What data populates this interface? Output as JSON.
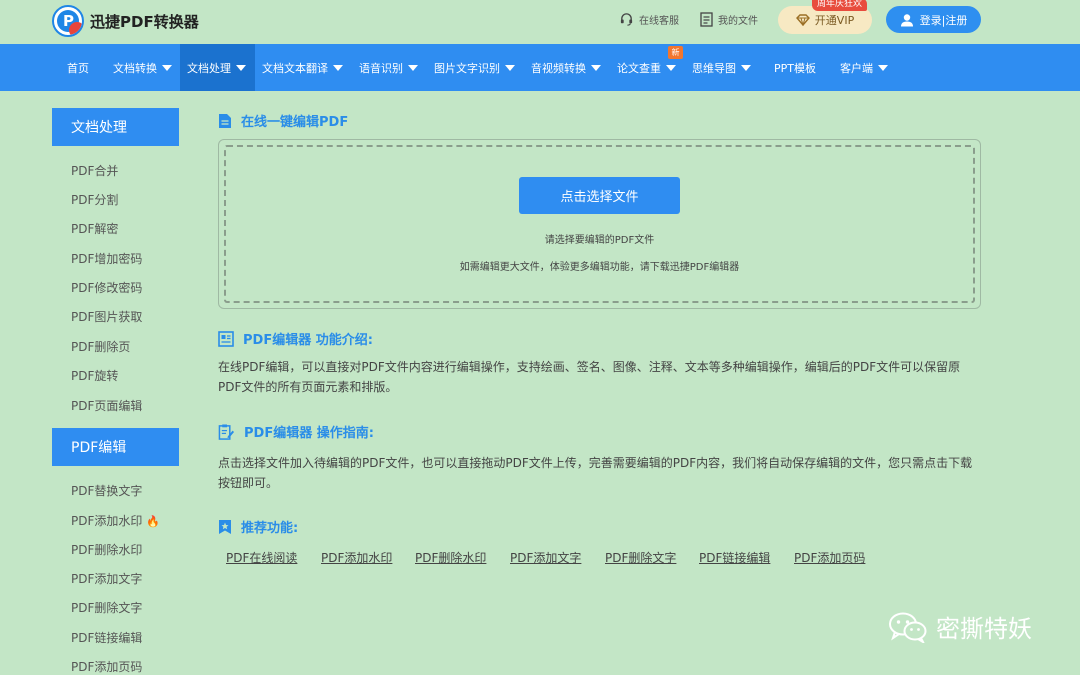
{
  "header": {
    "logo_text": "迅捷PDF转换器",
    "online_service": "在线客服",
    "my_files": "我的文件",
    "vip_badge": "周年庆狂欢",
    "vip_label": "开通VIP",
    "login_label": "登录|注册"
  },
  "nav": {
    "items": [
      {
        "label": "首页"
      },
      {
        "label": "文档转换"
      },
      {
        "label": "文档处理"
      },
      {
        "label": "文档文本翻译"
      },
      {
        "label": "语音识别"
      },
      {
        "label": "图片文字识别"
      },
      {
        "label": "音视频转换"
      },
      {
        "label": "论文查重"
      },
      {
        "label": "思维导图"
      },
      {
        "label": "PPT模板"
      },
      {
        "label": "客户端"
      }
    ],
    "new_badge": "新",
    "active": "文档处理"
  },
  "sidebar": {
    "group1_title": "文档处理",
    "group1_items": [
      {
        "label": "PDF合并"
      },
      {
        "label": "PDF分割"
      },
      {
        "label": "PDF解密"
      },
      {
        "label": "PDF增加密码"
      },
      {
        "label": "PDF修改密码"
      },
      {
        "label": "PDF图片获取"
      },
      {
        "label": "PDF删除页"
      },
      {
        "label": "PDF旋转"
      },
      {
        "label": "PDF页面编辑"
      }
    ],
    "group2_title": "PDF编辑",
    "group2_items": [
      {
        "label": "PDF替换文字"
      },
      {
        "label": "PDF添加水印"
      },
      {
        "label": "PDF删除水印"
      },
      {
        "label": "PDF添加文字"
      },
      {
        "label": "PDF删除文字"
      },
      {
        "label": "PDF链接编辑"
      },
      {
        "label": "PDF添加页码"
      }
    ]
  },
  "main": {
    "title": "在线一键编辑PDF",
    "choose_btn": "点击选择文件",
    "tip1": "请选择要编辑的PDF文件",
    "tip2": "如需编辑更大文件，体验更多编辑功能，请下载迅捷PDF编辑器",
    "intro_title": "PDF编辑器 功能介绍:",
    "intro_text": "在线PDF编辑，可以直接对PDF文件内容进行编辑操作，支持绘画、签名、图像、注释、文本等多种编辑操作，编辑后的PDF文件可以保留原PDF文件的所有页面元素和排版。",
    "guide_title": "PDF编辑器 操作指南:",
    "guide_text": "点击选择文件加入待编辑的PDF文件，也可以直接拖动PDF文件上传，完善需要编辑的PDF内容，我们将自动保存编辑的文件，您只需点击下载按钮即可。",
    "rec_title": "推荐功能:",
    "rec_links": [
      {
        "label": "PDF在线阅读"
      },
      {
        "label": "PDF添加水印"
      },
      {
        "label": "PDF删除水印"
      },
      {
        "label": "PDF添加文字"
      },
      {
        "label": "PDF删除文字"
      },
      {
        "label": "PDF链接编辑"
      },
      {
        "label": "PDF添加页码"
      }
    ]
  },
  "watermark": {
    "text": "密撕特妖"
  },
  "colors": {
    "primary": "#2f8df1",
    "active_nav": "#1b72cf",
    "background": "#c3e6c6",
    "title_blue": "#2a8de8"
  }
}
